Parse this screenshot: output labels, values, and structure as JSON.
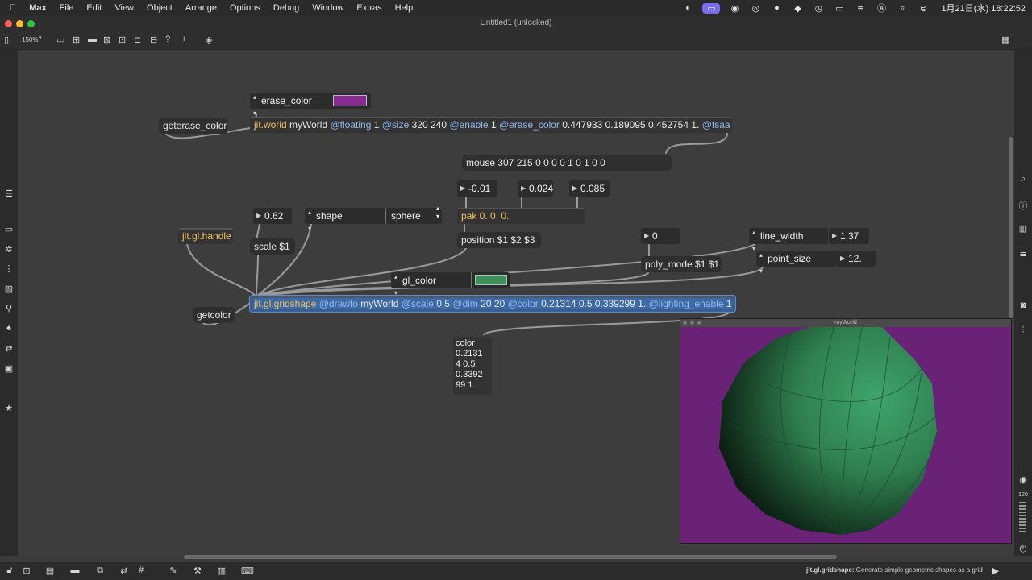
{
  "menubar": {
    "items": [
      "Max",
      "File",
      "Edit",
      "View",
      "Object",
      "Arrange",
      "Options",
      "Debug",
      "Window",
      "Extras",
      "Help"
    ],
    "datetime": "1月21日(水) 18:22:52",
    "status_icons": [
      "cc-icon",
      "screen-share-icon",
      "podcast-icon",
      "vpn-icon",
      "chat-icon",
      "cube-icon",
      "history-icon",
      "battery-icon",
      "wifi-icon",
      "input-a-icon",
      "search-icon",
      "control-center-icon"
    ]
  },
  "window": {
    "title": "Untitled1 (unlocked)",
    "zoom": "150%"
  },
  "patcher": {
    "erase_color_label": "erase_color",
    "getcolor_top_label": "geterase_color",
    "jit_world": {
      "name": "jit.world",
      "args": "myWorld",
      "attrs": [
        {
          "attr": "@floating",
          "val": "1"
        },
        {
          "attr": "@size",
          "val": "320 240"
        },
        {
          "attr": "@enable",
          "val": "1"
        },
        {
          "attr": "@erase_color",
          "val": "0.447933 0.189095 0.452754 1."
        },
        {
          "attr": "@fsaa",
          "val": ""
        }
      ]
    },
    "mouse_msg": "mouse 307 215 0 0 0 0 1 0 1 0 0",
    "num_x": "-0.01",
    "num_y": "0.024",
    "num_z": "0.085",
    "pak": "pak 0. 0. 0.",
    "position_msg": "position $1 $2 $3",
    "num_scale": "0.62",
    "scale_msg": "scale $1",
    "shape_label": "shape",
    "shape_menu": "sphere",
    "jit_handle": "jit.gl.handle",
    "polymode_num": "0",
    "polymode_msg": "poly_mode $1 $1",
    "line_width_label": "line_width",
    "line_width_num": "1.37",
    "point_size_label": "point_size",
    "point_size_num": "12.",
    "gl_color_label": "gl_color",
    "getcolor_label": "getcolor",
    "gridshape": {
      "name": "jit.gl.gridshape",
      "attrs": [
        {
          "attr": "@drawto",
          "val": "myWorld"
        },
        {
          "attr": "@scale",
          "val": "0.5"
        },
        {
          "attr": "@dim",
          "val": "20 20"
        },
        {
          "attr": "@color",
          "val": "0.21314 0.5 0.339299 1."
        },
        {
          "attr": "@lighting_enable",
          "val": "1"
        }
      ]
    },
    "print_lines": [
      "color",
      "0.2131",
      "4 0.5",
      "0.3392",
      "99 1."
    ]
  },
  "render_window": {
    "title": "myWorld",
    "erase_color": "#6a2277",
    "sphere_color": "#3a9a62"
  },
  "status_bar": {
    "object": "jit.gl.gridshape:",
    "description": "Generate simple geometric shapes as a grid"
  },
  "right_sidebar": {
    "level_value": "120"
  },
  "colors": {
    "accent": "#3d6aa5",
    "erase_swatch": "#862c8e",
    "color_swatch": "#3f8f5c"
  }
}
